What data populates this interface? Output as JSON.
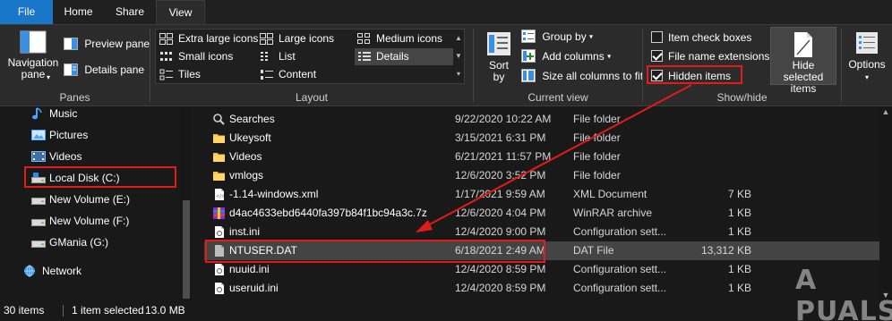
{
  "tabs": [
    "File",
    "Home",
    "Share",
    "View"
  ],
  "active_tab": "View",
  "ribbon": {
    "panes": {
      "group_label": "Panes",
      "navigation_pane": "Navigation\npane",
      "preview_pane": "Preview pane",
      "details_pane": "Details pane"
    },
    "layout": {
      "group_label": "Layout",
      "items": [
        "Extra large icons",
        "Large icons",
        "Medium icons",
        "Small icons",
        "List",
        "Details",
        "Tiles",
        "Content"
      ],
      "selected": "Details"
    },
    "current_view": {
      "group_label": "Current view",
      "sort_by": "Sort\nby",
      "group_by": "Group by",
      "add_columns": "Add columns",
      "size_all_columns": "Size all columns to fit"
    },
    "show_hide": {
      "group_label": "Show/hide",
      "item_check_boxes": "Item check boxes",
      "item_check_boxes_checked": false,
      "file_name_extensions": "File name extensions",
      "file_name_extensions_checked": true,
      "hidden_items": "Hidden items",
      "hidden_items_checked": true,
      "hide_selected_items": "Hide selected\nitems"
    },
    "options": "Options"
  },
  "nav": {
    "items": [
      {
        "label": "Music",
        "icon": "music-icon"
      },
      {
        "label": "Pictures",
        "icon": "pictures-icon"
      },
      {
        "label": "Videos",
        "icon": "videos-icon"
      },
      {
        "label": "Local Disk (C:)",
        "icon": "drive-icon"
      },
      {
        "label": "New Volume (E:)",
        "icon": "drive-icon"
      },
      {
        "label": "New Volume (F:)",
        "icon": "drive-icon"
      },
      {
        "label": "GMania (G:)",
        "icon": "drive-icon"
      },
      {
        "label": "Network",
        "icon": "network-icon"
      }
    ]
  },
  "files": [
    {
      "name": "Searches",
      "date": "9/22/2020 10:22 AM",
      "type": "File folder",
      "size": "",
      "icon": "search-folder-icon"
    },
    {
      "name": "Ukeysoft",
      "date": "3/15/2021 6:31 PM",
      "type": "File folder",
      "size": "",
      "icon": "folder-icon"
    },
    {
      "name": "Videos",
      "date": "6/21/2021 11:57 PM",
      "type": "File folder",
      "size": "",
      "icon": "folder-icon"
    },
    {
      "name": "vmlogs",
      "date": "12/6/2020 3:52 PM",
      "type": "File folder",
      "size": "",
      "icon": "folder-icon"
    },
    {
      "name": "-1.14-windows.xml",
      "date": "1/17/2021 9:59 AM",
      "type": "XML Document",
      "size": "7 KB",
      "icon": "xml-file-icon"
    },
    {
      "name": "d4ac4633ebd6440fa397b84f1bc94a3c.7z",
      "date": "12/6/2020 4:04 PM",
      "type": "WinRAR archive",
      "size": "1 KB",
      "icon": "archive-icon"
    },
    {
      "name": "inst.ini",
      "date": "12/4/2020 9:00 PM",
      "type": "Configuration sett...",
      "size": "1 KB",
      "icon": "ini-file-icon"
    },
    {
      "name": "NTUSER.DAT",
      "date": "6/18/2021 2:49 AM",
      "type": "DAT File",
      "size": "13,312 KB",
      "icon": "dat-file-icon",
      "selected": true
    },
    {
      "name": "nuuid.ini",
      "date": "12/4/2020 8:59 PM",
      "type": "Configuration sett...",
      "size": "1 KB",
      "icon": "ini-file-icon"
    },
    {
      "name": "useruid.ini",
      "date": "12/4/2020 8:59 PM",
      "type": "Configuration sett...",
      "size": "1 KB",
      "icon": "ini-file-icon"
    }
  ],
  "status": {
    "items_count": "30 items",
    "selected_info": "1 item selected",
    "selected_size": "13.0 MB"
  },
  "watermark": "A PUALS",
  "colors": {
    "accent": "#1976c9",
    "highlight_red": "#e21a1a"
  }
}
